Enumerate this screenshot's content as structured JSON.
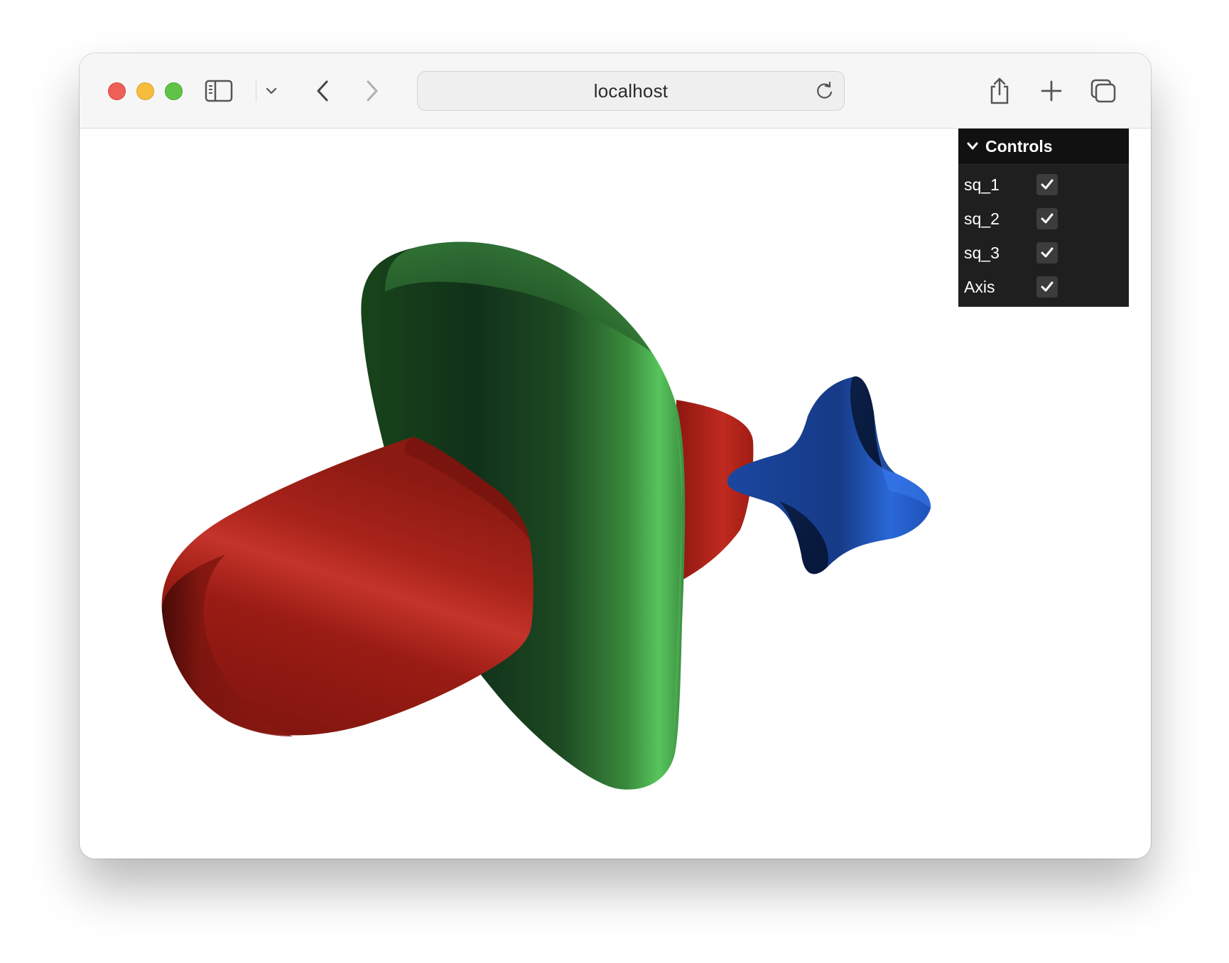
{
  "browser": {
    "url": "localhost",
    "traffic_lights": [
      "close",
      "minimize",
      "zoom"
    ],
    "icons": [
      "sidebar-icon",
      "chevron-down-icon",
      "back-icon",
      "forward-icon",
      "reload-icon",
      "share-icon",
      "new-tab-icon",
      "tabs-overview-icon"
    ]
  },
  "controls": {
    "title": "Controls",
    "items": [
      {
        "label": "sq_1",
        "checked": true
      },
      {
        "label": "sq_2",
        "checked": true
      },
      {
        "label": "sq_3",
        "checked": true
      },
      {
        "label": "Axis",
        "checked": true
      }
    ]
  },
  "scene": {
    "objects": [
      {
        "name": "red-superquadric",
        "color": "#b3251d"
      },
      {
        "name": "green-superquadric",
        "color": "#3e8f3c"
      },
      {
        "name": "blue-superquadric",
        "color": "#1f4fa8"
      }
    ]
  }
}
